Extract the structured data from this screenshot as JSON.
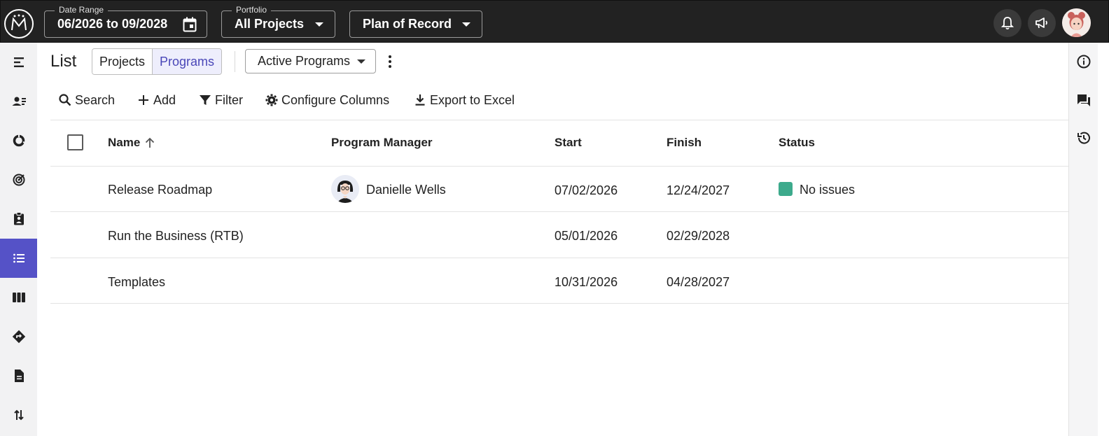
{
  "topbar": {
    "date_range": {
      "legend": "Date Range",
      "value": "06/2026 to 09/2028"
    },
    "portfolio": {
      "legend": "Portfolio",
      "value": "All Projects"
    },
    "plan": {
      "value": "Plan of Record"
    }
  },
  "sidebar": {
    "items": [
      {
        "icon": "gantt-icon"
      },
      {
        "icon": "resource-icon"
      },
      {
        "icon": "portfolio-donut-icon"
      },
      {
        "icon": "target-icon"
      },
      {
        "icon": "clipboard-icon"
      },
      {
        "icon": "list-icon",
        "active": true
      },
      {
        "icon": "columns-icon"
      },
      {
        "icon": "roadmap-icon"
      },
      {
        "icon": "document-icon"
      },
      {
        "icon": "sort-arrows-icon"
      }
    ]
  },
  "header": {
    "title": "List",
    "toggle": [
      "Projects",
      "Programs"
    ],
    "selected_toggle": "Programs",
    "view_select": "Active Programs"
  },
  "toolbar": {
    "search": "Search",
    "add": "Add",
    "filter": "Filter",
    "configure": "Configure Columns",
    "export": "Export to Excel"
  },
  "table": {
    "columns": [
      "Name",
      "Program Manager",
      "Start",
      "Finish",
      "Status"
    ],
    "sort": {
      "column": "Name",
      "direction": "ascending"
    },
    "rows": [
      {
        "name": "Release Roadmap",
        "manager": "Danielle Wells",
        "start": "07/02/2026",
        "finish": "12/24/2027",
        "status": "No issues",
        "status_color": "#3daa8c"
      },
      {
        "name": "Run the Business (RTB)",
        "manager": "",
        "start": "05/01/2026",
        "finish": "02/29/2028",
        "status": ""
      },
      {
        "name": "Templates",
        "manager": "",
        "start": "10/31/2026",
        "finish": "04/28/2027",
        "status": ""
      }
    ]
  },
  "colors": {
    "accent": "#5552c7",
    "topbar": "#222222",
    "status_ok": "#3daa8c"
  }
}
